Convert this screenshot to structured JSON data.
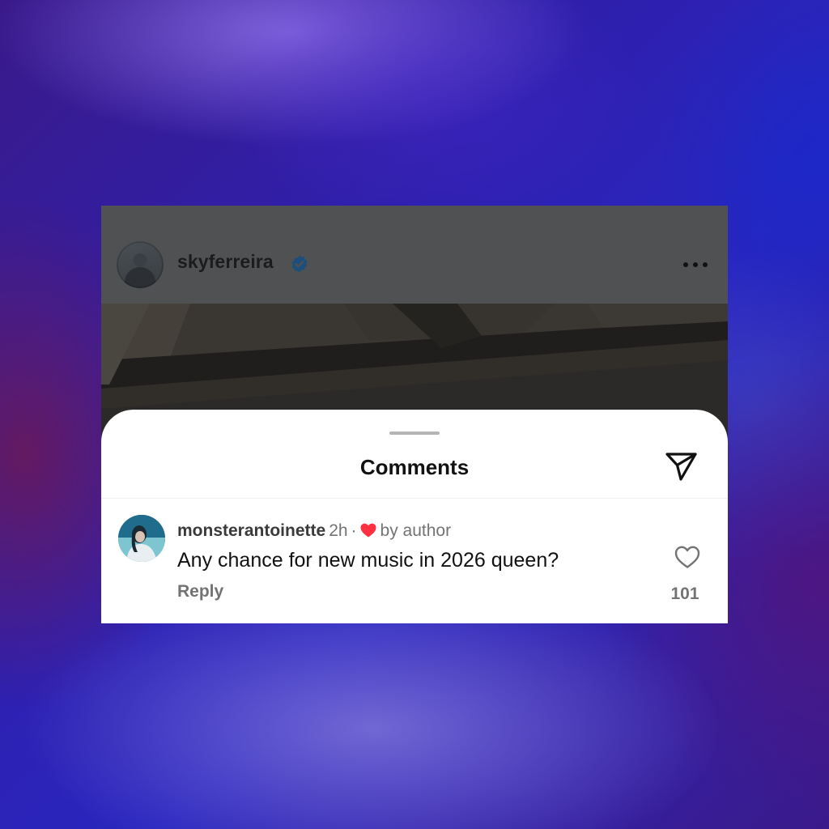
{
  "post": {
    "username": "skyferreira",
    "verified_icon": "verified-badge-icon",
    "more_icon": "more-horizontal-icon"
  },
  "comments_sheet": {
    "title": "Comments",
    "share_icon": "send-paper-plane-icon",
    "comments": [
      {
        "username": "monsterantoinette",
        "time": "2h",
        "separator": "·",
        "liked_by_author_label": "by author",
        "text": "Any chance for new music in 2026 queen?",
        "reply_label": "Reply",
        "like_count": "101",
        "like_icon": "heart-outline-icon"
      }
    ]
  },
  "colors": {
    "verified_blue": "#0095f6",
    "author_heart_red": "#ff3040",
    "muted_text": "#737373",
    "sheet_background": "#ffffff"
  }
}
